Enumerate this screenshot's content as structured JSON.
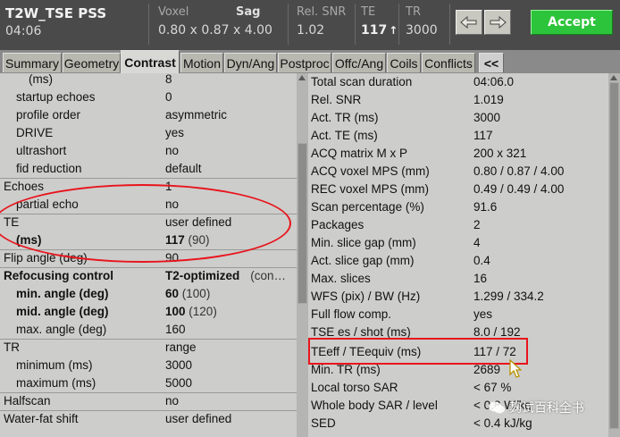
{
  "header": {
    "scan_name": "T2W_TSE PSS",
    "scan_time": "04:06",
    "voxel_label": "Voxel",
    "voxel_value": "0.80 x 0.87 x 4.00",
    "orientation": "Sag",
    "snr_label": "Rel. SNR",
    "snr_value": "1.02",
    "te_label": "TE",
    "te_value": "117",
    "te_arrow": "↑",
    "tr_label": "TR",
    "tr_value": "3000",
    "accept_label": "Accept"
  },
  "tabs": [
    {
      "label": "Summary"
    },
    {
      "label": "Geometry"
    },
    {
      "label": "Contrast"
    },
    {
      "label": "Motion"
    },
    {
      "label": "Dyn/Ang"
    },
    {
      "label": "Postproc"
    },
    {
      "label": "Offc/Ang"
    },
    {
      "label": "Coils"
    },
    {
      "label": "Conflicts"
    },
    {
      "label": "<<"
    }
  ],
  "left_rows": [
    {
      "key": "(ms)",
      "value": "8"
    },
    {
      "key": "startup echoes",
      "value": "0"
    },
    {
      "key": "profile order",
      "value": "asymmetric"
    },
    {
      "key": "DRIVE",
      "value": "yes"
    },
    {
      "key": "ultrashort",
      "value": "no"
    },
    {
      "key": "fid reduction",
      "value": "default"
    },
    {
      "key": "Echoes",
      "value": "1"
    },
    {
      "key": "partial echo",
      "value": "no"
    },
    {
      "key": "TE",
      "value": "user defined"
    },
    {
      "key": "(ms)",
      "value": "117",
      "paren": "(90)"
    },
    {
      "key": "Flip angle (deg)",
      "value": "90"
    },
    {
      "key": "Refocusing control",
      "value": "T2-optimized",
      "extra": "(con…"
    },
    {
      "key": "min. angle (deg)",
      "value": "60",
      "paren": "(100)"
    },
    {
      "key": "mid. angle (deg)",
      "value": "100",
      "paren": "(120)"
    },
    {
      "key": "max. angle (deg)",
      "value": "160"
    },
    {
      "key": "TR",
      "value": "range"
    },
    {
      "key": "minimum (ms)",
      "value": "3000"
    },
    {
      "key": "maximum (ms)",
      "value": "5000"
    },
    {
      "key": "Halfscan",
      "value": "no"
    },
    {
      "key": "Water-fat shift",
      "value": "user defined"
    }
  ],
  "right_rows": [
    {
      "key": "Total scan duration",
      "value": "04:06.0"
    },
    {
      "key": "Rel. SNR",
      "value": "1.019"
    },
    {
      "key": "Act. TR (ms)",
      "value": "3000"
    },
    {
      "key": "Act. TE (ms)",
      "value": "117"
    },
    {
      "key": "ACQ matrix M x P",
      "value": "200 x 321"
    },
    {
      "key": "ACQ voxel MPS (mm)",
      "value": "0.80 / 0.87 / 4.00"
    },
    {
      "key": "REC voxel MPS (mm)",
      "value": "0.49 / 0.49 / 4.00"
    },
    {
      "key": "Scan percentage (%)",
      "value": "91.6"
    },
    {
      "key": "Packages",
      "value": "2"
    },
    {
      "key": "Min. slice gap (mm)",
      "value": "4"
    },
    {
      "key": "Act. slice gap (mm)",
      "value": "0.4"
    },
    {
      "key": "Max. slices",
      "value": "16"
    },
    {
      "key": "WFS (pix) / BW (Hz)",
      "value": "1.299 / 334.2"
    },
    {
      "key": "Full flow comp.",
      "value": "yes"
    },
    {
      "key": "TSE es / shot (ms)",
      "value": "8.0 / 192"
    },
    {
      "key": "TEeff / TEequiv (ms)",
      "value": "117 / 72"
    },
    {
      "key": "Min. TR (ms)",
      "value": "2689"
    },
    {
      "key": "Local torso SAR",
      "value": "< 67 %"
    },
    {
      "key": "Whole body SAR / level",
      "value": "< 0.8 W/kg"
    },
    {
      "key": "SED",
      "value": "< 0.4 kJ/kg"
    }
  ],
  "watermark": "麴试百科全书",
  "colors": {
    "header_bg": "#4a4a4a",
    "panel_bg": "#cdcdcb",
    "accept_green": "#2cc43a",
    "annotation_red": "#e8141c"
  }
}
